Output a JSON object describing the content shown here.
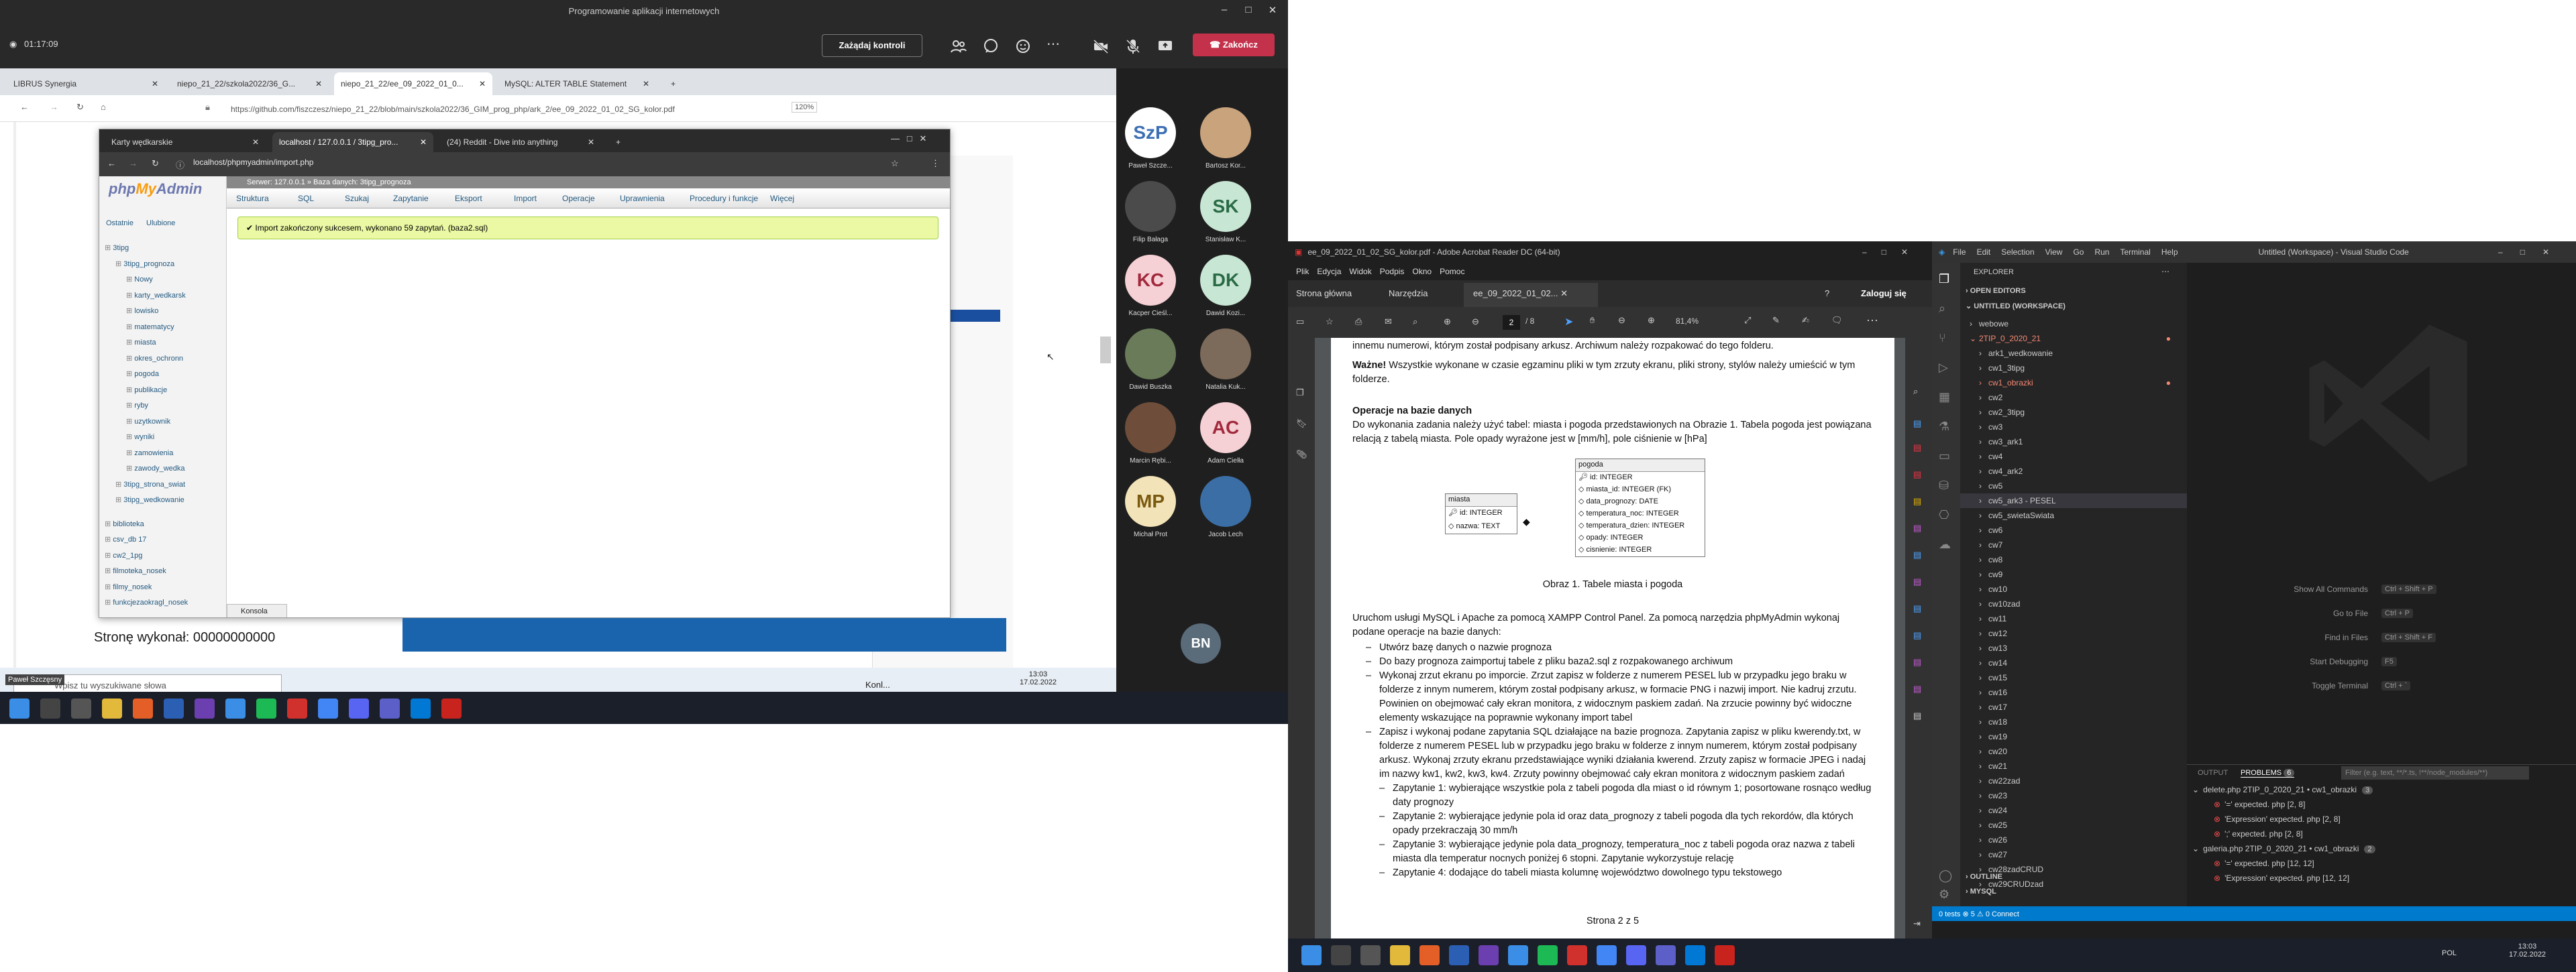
{
  "meeting": {
    "title": "Programowanie aplikacji internetowych",
    "timer": "01:17:09",
    "control_label": "Zażądaj kontroli",
    "end_label": "Zakończ",
    "participants": [
      {
        "initials": "SzP",
        "name": "Paweł Szcze...",
        "bg": "#ffffff",
        "fg": "#3d6fb4"
      },
      {
        "initials": "",
        "name": "Bartosz Kor...",
        "bg": "#c9a37c",
        "fg": "#333"
      },
      {
        "initials": "",
        "name": "Filip Bałaga",
        "bg": "#4b4b4b",
        "fg": "#fff"
      },
      {
        "initials": "SK",
        "name": "Stanisław K...",
        "bg": "#c8e6d4",
        "fg": "#2a6b46"
      },
      {
        "initials": "KC",
        "name": "Kacper Cieśl...",
        "bg": "#f5d0d5",
        "fg": "#a1293c"
      },
      {
        "initials": "DK",
        "name": "Dawid Kozi...",
        "bg": "#c8e6d4",
        "fg": "#2a6b46"
      },
      {
        "initials": "",
        "name": "Dawid Buszka",
        "bg": "#6a7b5a",
        "fg": "#fff"
      },
      {
        "initials": "",
        "name": "Natalia Kuk...",
        "bg": "#7c6a5a",
        "fg": "#fff"
      },
      {
        "initials": "",
        "name": "Marcin Rębi...",
        "bg": "#6e4e3a",
        "fg": "#fff"
      },
      {
        "initials": "AC",
        "name": "Adam Cielła",
        "bg": "#f5d0d5",
        "fg": "#a1293c"
      },
      {
        "initials": "MP",
        "name": "Michał Prot",
        "bg": "#f3e3b8",
        "fg": "#7a5a10"
      },
      {
        "initials": "",
        "name": "Jacob Lech",
        "bg": "#3a6ea5",
        "fg": "#fff"
      }
    ],
    "bn": "BN"
  },
  "share": {
    "tabs": [
      "LIBRUS Synergia",
      "niepo_21_22/szkola2022/36_G...",
      "niepo_21_22/ee_09_2022_01_0...",
      "MySQL: ALTER TABLE Statement"
    ],
    "url": "https://github.com/fiszczesz/niepo_21_22/blob/main/szkola2022/36_GIM_prog_php/ark_2/ee_09_2022_01_02_SG_kolor.pdf",
    "zoom": "120%",
    "bottom_text": "Stronę wykonał: 00000000000",
    "search_placeholder": "Wpisz tu wyszukiwane słowa",
    "presenter_tag": "Paweł Szczęsny",
    "weather": "Konl...",
    "clock_time": "13:03",
    "clock_date": "17.02.2022"
  },
  "pma": {
    "tabs": [
      "Karty wędkarskie",
      "localhost / 127.0.0.1 / 3tipg_pro...",
      "(24) Reddit - Dive into anything"
    ],
    "url": "localhost/phpmyadmin/import.php",
    "server": "Serwer: 127.0.0.1 » Baza danych: 3tipg_prognoza",
    "recent": "Ostatnie",
    "favs": "Ulubione",
    "tree": [
      "3tipg",
      "3tipg_prognoza",
      "Nowy",
      "karty_wedkarsk",
      "lowisko",
      "matematycy",
      "miasta",
      "okres_ochronn",
      "pogoda",
      "publikacje",
      "ryby",
      "uzytkownik",
      "wyniki",
      "zamowienia",
      "zawody_wedka",
      "3tipg_strona_swiat",
      "3tipg_wedkowanie",
      "biblioteka",
      "csv_db 17",
      "cw2_1pg",
      "filmoteka_nosek",
      "filmy_nosek",
      "funkcjezaokragl_nosek"
    ],
    "menu": [
      "Struktura",
      "SQL",
      "Szukaj",
      "Zapytanie",
      "Eksport",
      "Import",
      "Operacje",
      "Uprawnienia",
      "Procedury i funkcje",
      "Więcej"
    ],
    "success": "Import zakończony sukcesem, wykonano 59 zapytań. (baza2.sql)",
    "console": "Konsola"
  },
  "acrobat": {
    "title": "ee_09_2022_01_02_SG_kolor.pdf - Adobe Acrobat Reader DC (64-bit)",
    "menu": [
      "Plik",
      "Edycja",
      "Widok",
      "Podpis",
      "Okno",
      "Pomoc"
    ],
    "tabs": [
      "Strona główna",
      "Narzędzia",
      "ee_09_2022_01_02..."
    ],
    "login": "Zaloguj się",
    "page": "2",
    "pages": "/ 8",
    "zoom": "81,4%",
    "pdf": {
      "p1": "innemu numerowi, którym został podpisany arkusz. Archiwum należy rozpakować do tego folderu.",
      "p2_bold": "Ważne!",
      "p2": " Wszystkie wykonane w czasie egzaminu pliki w tym zrzuty ekranu, pliki strony, stylów należy umieścić w tym folderze.",
      "h1": "Operacje na bazie danych",
      "p3": "Do wykonania zadania należy użyć tabel: miasta i pogoda przedstawionych na Obrazie 1. Tabela pogoda jest powiązana relacją z tabelą miasta. Pole opady wyrażone jest w [mm/h], pole ciśnienie w [hPa]",
      "t_miasta": "miasta",
      "miasta_cols": [
        "id: INTEGER",
        "nazwa: TEXT"
      ],
      "t_pogoda": "pogoda",
      "pogoda_cols": [
        "id: INTEGER",
        "miasta_id: INTEGER (FK)",
        "data_prognozy: DATE",
        "temperatura_noc: INTEGER",
        "temperatura_dzien: INTEGER",
        "opady: INTEGER",
        "cisnienie: INTEGER"
      ],
      "caption": "Obraz 1. Tabele miasta i pogoda",
      "p4": "Uruchom usługi MySQL i Apache za pomocą XAMPP Control Panel. Za pomocą narzędzia phpMyAdmin wykonaj podane operacje na bazie danych:",
      "list": [
        "Utwórz bazę danych o nazwie prognoza",
        "Do bazy prognoza zaimportuj tabele z pliku baza2.sql z rozpakowanego archiwum",
        "Wykonaj zrzut ekranu po imporcie. Zrzut zapisz w folderze z numerem PESEL lub w przypadku jego braku w folderze z innym numerem, którym został podpisany arkusz, w formacie PNG i nazwij import. Nie kadruj zrzutu. Powinien on obejmować cały ekran monitora, z widocznym paskiem zadań. Na zrzucie powinny być widoczne elementy wskazujące na poprawnie wykonany import tabel",
        "Zapisz i wykonaj podane zapytania SQL działające na bazie prognoza. Zapytania zapisz w pliku kwerendy.txt, w folderze z numerem PESEL lub w przypadku jego braku w folderze z innym numerem, którym został podpisany arkusz. Wykonaj zrzuty ekranu przedstawiające wyniki działania kwerend. Zrzuty zapisz w formacie JPEG i nadaj im nazwy kw1, kw2, kw3, kw4. Zrzuty powinny obejmować cały ekran monitora z widocznym paskiem zadań"
      ],
      "sublist": [
        "Zapytanie 1: wybierające wszystkie pola z tabeli pogoda dla miast o id równym 1; posortowane rosnąco według daty prognozy",
        "Zapytanie 2: wybierające jedynie pola id oraz data_prognozy z tabeli pogoda dla tych rekordów, dla których opady przekraczają 30 mm/h",
        "Zapytanie 3: wybierające jedynie pola data_prognozy, temperatura_noc z tabeli pogoda oraz nazwa z tabeli miasta dla temperatur nocnych poniżej 6 stopni. Zapytanie wykorzystuje relację",
        "Zapytanie 4: dodające do tabeli miasta kolumnę województwo dowolnego typu tekstowego"
      ],
      "footer": "Strona 2 z 5"
    }
  },
  "vscode": {
    "title": "Untitled (Workspace) - Visual Studio Code",
    "menu": [
      "File",
      "Edit",
      "Selection",
      "View",
      "Go",
      "Run",
      "Terminal",
      "Help"
    ],
    "explorer": "EXPLORER",
    "open_editors": "OPEN EDITORS",
    "workspace": "UNTITLED (WORKSPACE)",
    "files": [
      "webowe",
      "2TIP_0_2020_21",
      "ark1_wedkowanie",
      "cw1_3tipg",
      "cw1_obrazki",
      "cw2",
      "cw2_3tipg",
      "cw3",
      "cw3_ark1",
      "cw4",
      "cw4_ark2",
      "cw5",
      "cw5_ark3 - PESEL",
      "cw5_swietaSwiata",
      "cw6",
      "cw7",
      "cw8",
      "cw9",
      "cw10",
      "cw10zad",
      "cw11",
      "cw12",
      "cw13",
      "cw14",
      "cw15",
      "cw16",
      "cw17",
      "cw18",
      "cw19",
      "cw20",
      "cw21",
      "cw22zad",
      "cw23",
      "cw24",
      "cw25",
      "cw26",
      "cw27",
      "cw28zadCRUD",
      "cw29CRUDzad"
    ],
    "outline": "OUTLINE",
    "mysql": "MYSQL",
    "shortcuts": [
      {
        "label": "Show All Commands",
        "keys": "Ctrl + Shift + P"
      },
      {
        "label": "Go to File",
        "keys": "Ctrl + P"
      },
      {
        "label": "Find in Files",
        "keys": "Ctrl + Shift + F"
      },
      {
        "label": "Start Debugging",
        "keys": "F5"
      },
      {
        "label": "Toggle Terminal",
        "keys": "Ctrl + `"
      }
    ],
    "panel_tabs": [
      "OUTPUT",
      "PROBLEMS"
    ],
    "problem_count": "6",
    "filter": "Filter (e.g. text, **/*.ts, !**/node_modules/**)",
    "problems": [
      {
        "kind": "file",
        "text": "delete.php  2TIP_0_2020_21 • cw1_obrazki",
        "count": "3"
      },
      {
        "kind": "err",
        "text": "'=' expected. php [2, 8]"
      },
      {
        "kind": "err",
        "text": "'Expression' expected. php [2, 8]"
      },
      {
        "kind": "err",
        "text": "';' expected. php [2, 8]"
      },
      {
        "kind": "file",
        "text": "galeria.php  2TIP_0_2020_21 • cw1_obrazki",
        "count": "2"
      },
      {
        "kind": "err",
        "text": "'=' expected. php [12, 12]"
      },
      {
        "kind": "err",
        "text": "'Expression' expected. php [12, 12]"
      }
    ],
    "status": "0 tests   ⊗ 5 ⚠ 0   Connect"
  },
  "taskbar": {
    "lang": "POL",
    "time": "13:03",
    "date": "17.02.2022"
  }
}
